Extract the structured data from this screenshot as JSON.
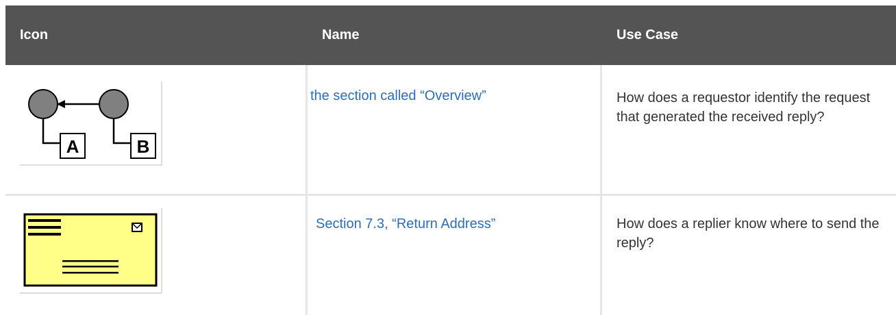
{
  "table": {
    "headers": {
      "icon": "Icon",
      "name": "Name",
      "use_case": "Use Case"
    },
    "rows": [
      {
        "icon": "correlation-identifier-icon",
        "icon_labels": [
          "A",
          "B"
        ],
        "name": "the section called “Overview”",
        "use_case": "How does a requestor identify the request that generated the received reply?"
      },
      {
        "icon": "return-address-envelope-icon",
        "name": "Section 7.3, “Return Address”",
        "use_case": "How does a replier know where to send the reply?"
      }
    ]
  },
  "colors": {
    "header_bg": "#545454",
    "link": "#2a6ebb",
    "envelope_fill": "#ffff88"
  }
}
